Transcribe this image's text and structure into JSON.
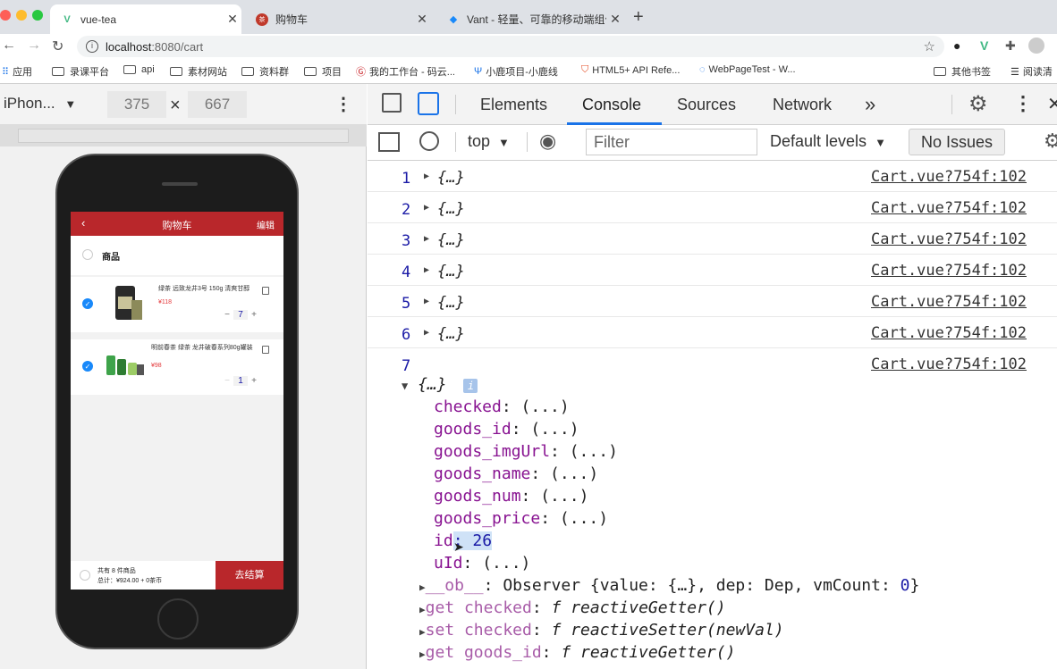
{
  "browser": {
    "tabs": [
      {
        "title": "vue-tea",
        "active": true
      },
      {
        "title": "购物车",
        "active": false
      },
      {
        "title": "Vant - 轻量、可靠的移动端组件",
        "active": false
      }
    ],
    "url_host": "localhost",
    "url_rest": ":8080/cart",
    "bookmarks": [
      "应用",
      "录课平台",
      "api",
      "素材网站",
      "资料群",
      "项目",
      "我的工作台 - 码云...",
      "小鹿项目-小鹿线",
      "HTML5+ API Refe...",
      "WebPageTest - W...",
      "其他书签",
      "阅读清"
    ]
  },
  "device_toolbar": {
    "device": "iPhon...",
    "width": "375",
    "times": "×",
    "height": "667"
  },
  "app": {
    "title": "购物车",
    "back": "‹",
    "edit": "编辑",
    "header_label": "商品",
    "items": [
      {
        "name": "绿茶 远致龙井3号 150g 清爽甘醇",
        "price": "¥118",
        "qty": "7",
        "checked": true
      },
      {
        "name": "明前春茶 绿茶 龙井破春系列80g罐装",
        "price": "¥98",
        "qty": "1",
        "checked": true
      }
    ],
    "summary_line1": "共有 8 件商品",
    "summary_line2": "总计：¥924.00 + 0茶币",
    "checkout": "去结算"
  },
  "devtools": {
    "tabs": [
      "Elements",
      "Console",
      "Sources",
      "Network"
    ],
    "active_tab": "Console",
    "more": "»",
    "context": "top",
    "filter_placeholder": "Filter",
    "levels": "Default levels",
    "issues": "No Issues",
    "logs": [
      {
        "n": "1",
        "obj": "{…}",
        "src": "Cart.vue?754f:102"
      },
      {
        "n": "2",
        "obj": "{…}",
        "src": "Cart.vue?754f:102"
      },
      {
        "n": "3",
        "obj": "{…}",
        "src": "Cart.vue?754f:102"
      },
      {
        "n": "4",
        "obj": "{…}",
        "src": "Cart.vue?754f:102"
      },
      {
        "n": "5",
        "obj": "{…}",
        "src": "Cart.vue?754f:102"
      },
      {
        "n": "6",
        "obj": "{…}",
        "src": "Cart.vue?754f:102"
      },
      {
        "n": "7",
        "obj": "",
        "src": "Cart.vue?754f:102"
      }
    ],
    "expanded_obj": "{…}",
    "props": [
      {
        "key": "checked",
        "val": ": (...)"
      },
      {
        "key": "goods_id",
        "val": ": (...)"
      },
      {
        "key": "goods_imgUrl",
        "val": ": (...)"
      },
      {
        "key": "goods_name",
        "val": ": (...)"
      },
      {
        "key": "goods_num",
        "val": ": (...)"
      },
      {
        "key": "goods_price",
        "val": ": (...)"
      }
    ],
    "id_key": "id",
    "id_val": ": 26",
    "uid_key": "uId",
    "uid_val": ": (...)",
    "ob_key": "__ob__",
    "ob_val": ": Observer {value: {…}, dep: Dep, vmCount: ",
    "ob_num": "0",
    "ob_end": "}",
    "getters": [
      {
        "pre": "get checked",
        "fn": "f reactiveGetter()"
      },
      {
        "pre": "set checked",
        "fn": "f reactiveSetter(newVal)"
      },
      {
        "pre": "get goods_id",
        "fn": "f reactiveGetter()"
      }
    ]
  }
}
